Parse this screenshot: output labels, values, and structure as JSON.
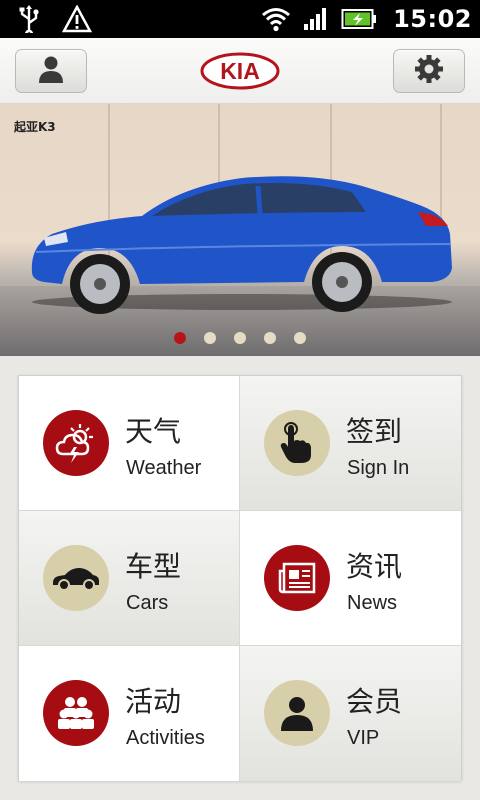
{
  "status_bar": {
    "time": "15:02",
    "icons": [
      "usb-icon",
      "warning-icon",
      "wifi-icon",
      "signal-icon",
      "battery-charging-icon"
    ]
  },
  "header": {
    "logo_text": "KIA",
    "left_button_icon": "user-icon",
    "right_button_icon": "gear-icon",
    "brand_color": "#b3141b"
  },
  "banner": {
    "caption": "起亚K3",
    "slide_count": 5,
    "active_slide": 1
  },
  "menu": {
    "items": [
      {
        "zh": "天气",
        "en": "Weather",
        "icon": "weather-icon"
      },
      {
        "zh": "签到",
        "en": "Sign In",
        "icon": "tap-hand-icon"
      },
      {
        "zh": "车型",
        "en": "Cars",
        "icon": "car-icon"
      },
      {
        "zh": "资讯",
        "en": "News",
        "icon": "newspaper-icon"
      },
      {
        "zh": "活动",
        "en": "Activities",
        "icon": "people-group-icon"
      },
      {
        "zh": "会员",
        "en": "VIP",
        "icon": "member-icon"
      }
    ]
  }
}
